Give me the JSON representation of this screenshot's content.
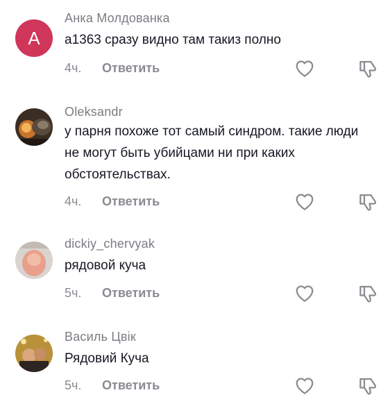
{
  "comments": [
    {
      "username": "Анка Молдованка",
      "avatar_letter": "А",
      "avatar_color": "#d0365a",
      "text": "а1363 сразу видно там такиз полно",
      "time": "4ч.",
      "reply_label": "Ответить"
    },
    {
      "username": "Oleksandr",
      "text": "у парня похоже тот самый синдром. такие люди не могут быть убийцами ни при каких обстоятельствах.",
      "time": "4ч.",
      "reply_label": "Ответить"
    },
    {
      "username": "dickiy_chervyak",
      "text": "рядовой куча",
      "time": "5ч.",
      "reply_label": "Ответить"
    },
    {
      "username": "Василь Цвік",
      "text": "Рядовий Куча",
      "time": "5ч.",
      "reply_label": "Ответить"
    }
  ]
}
